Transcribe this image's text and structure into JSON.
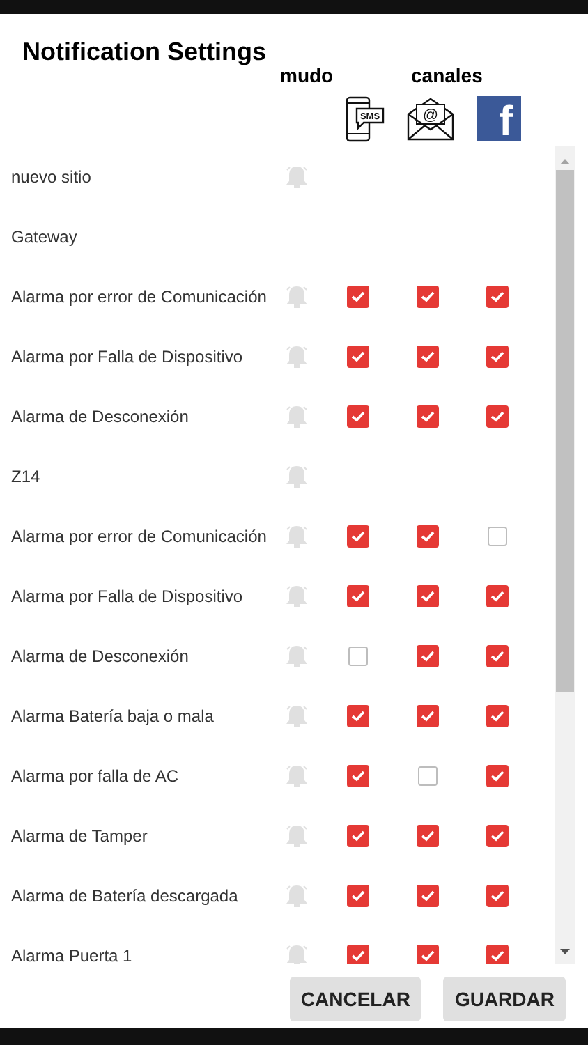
{
  "title": "Notification Settings",
  "header": {
    "mute_label": "mudo",
    "channels_label": "canales",
    "sms_icon_text": "SMS",
    "email_icon_text": "@",
    "facebook_icon_text": "f"
  },
  "rows": [
    {
      "kind": "group",
      "label": "nuevo sitio",
      "mute_icon": true
    },
    {
      "kind": "group",
      "label": "Gateway",
      "mute_icon": false
    },
    {
      "kind": "alarm",
      "label": "Alarma por error de Comunicación",
      "mute_icon": true,
      "channels": [
        {
          "checked": true
        },
        {
          "checked": true
        },
        {
          "checked": true
        }
      ]
    },
    {
      "kind": "alarm",
      "label": "Alarma por Falla de Dispositivo",
      "mute_icon": true,
      "channels": [
        {
          "checked": true
        },
        {
          "checked": true
        },
        {
          "checked": true
        }
      ]
    },
    {
      "kind": "alarm",
      "label": "Alarma de Desconexión",
      "mute_icon": true,
      "channels": [
        {
          "checked": true
        },
        {
          "checked": true
        },
        {
          "checked": true
        }
      ]
    },
    {
      "kind": "group",
      "label": "Z14",
      "mute_icon": true
    },
    {
      "kind": "alarm",
      "label": "Alarma por error de Comunicación",
      "mute_icon": true,
      "channels": [
        {
          "checked": true
        },
        {
          "checked": true
        },
        {
          "checked": false
        }
      ]
    },
    {
      "kind": "alarm",
      "label": "Alarma por Falla de Dispositivo",
      "mute_icon": true,
      "channels": [
        {
          "checked": true
        },
        {
          "checked": true
        },
        {
          "checked": true
        }
      ]
    },
    {
      "kind": "alarm",
      "label": "Alarma de Desconexión",
      "mute_icon": true,
      "channels": [
        {
          "checked": false
        },
        {
          "checked": true
        },
        {
          "checked": true
        }
      ]
    },
    {
      "kind": "alarm",
      "label": "Alarma Batería baja o mala",
      "mute_icon": true,
      "channels": [
        {
          "checked": true
        },
        {
          "checked": true
        },
        {
          "checked": true
        }
      ]
    },
    {
      "kind": "alarm",
      "label": "Alarma por falla de AC",
      "mute_icon": true,
      "channels": [
        {
          "checked": true
        },
        {
          "checked": false
        },
        {
          "checked": true
        }
      ]
    },
    {
      "kind": "alarm",
      "label": "Alarma de Tamper",
      "mute_icon": true,
      "channels": [
        {
          "checked": true
        },
        {
          "checked": true
        },
        {
          "checked": true
        }
      ]
    },
    {
      "kind": "alarm",
      "label": "Alarma de Batería descargada",
      "mute_icon": true,
      "channels": [
        {
          "checked": true
        },
        {
          "checked": true
        },
        {
          "checked": true
        }
      ]
    },
    {
      "kind": "alarm",
      "label": "Alarma Puerta 1",
      "mute_icon": true,
      "channels": [
        {
          "checked": true
        },
        {
          "checked": true
        },
        {
          "checked": true
        }
      ]
    }
  ],
  "buttons": [
    "CANCELAR",
    "GUARDAR"
  ]
}
